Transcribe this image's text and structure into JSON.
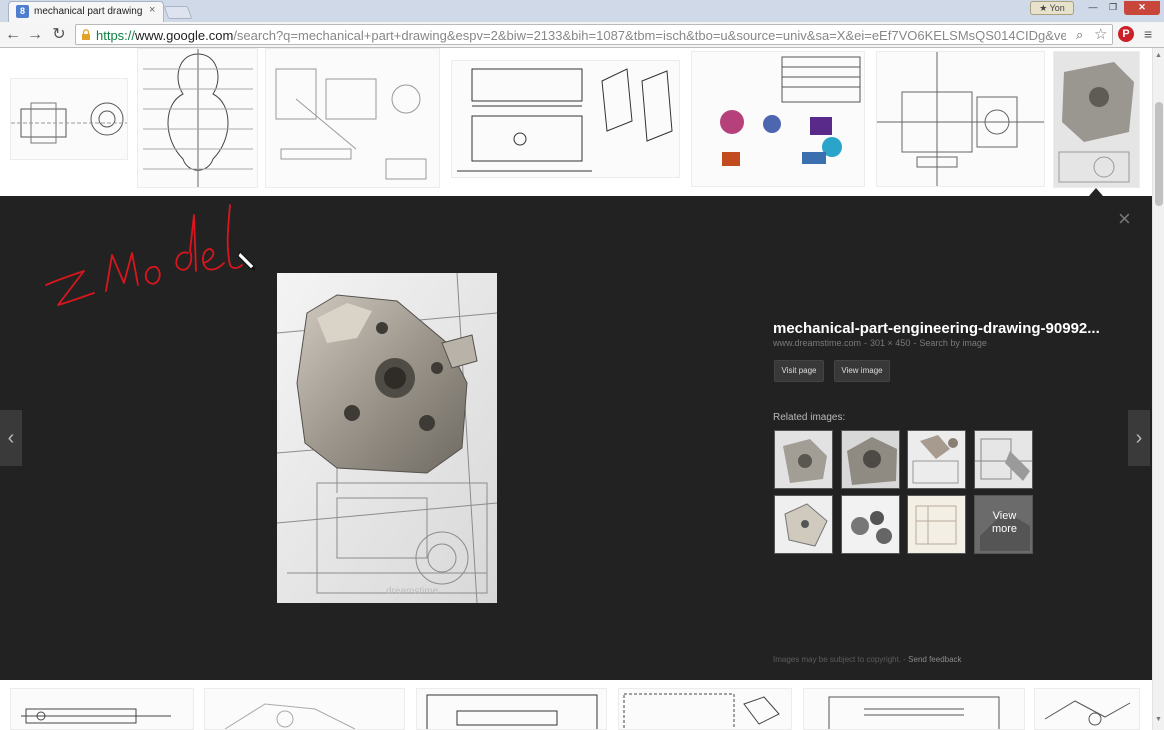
{
  "browser": {
    "tab_title": "mechanical part drawing",
    "tab_favicon": "8",
    "tab_close": "×",
    "profile_label": "Yon",
    "url_scheme": "https://",
    "url_host": "www.google.com",
    "url_rest": "/search?q=mechanical+part+drawing&espv=2&biw=2133&bih=1087&tbm=isch&tbo=u&source=univ&sa=X&ei=eEf7VO6KELSMsQS014CIDg&ved",
    "icons": [
      "back-icon",
      "forward-icon",
      "reload-icon",
      "lock-icon",
      "search-icon",
      "star-icon",
      "pinterest-icon",
      "menu-icon"
    ]
  },
  "preview": {
    "title": "mechanical-part-engineering-drawing-90992...",
    "source_domain": "www.dreamstime.com",
    "dimensions": "301 × 450",
    "search_by_image": "Search by image",
    "visit_page_label": "Visit page",
    "view_image_label": "View image",
    "related_label": "Related images:",
    "view_more_line1": "View",
    "view_more_line2": "more",
    "watermark_text": "dreamstime",
    "copyright_text": "Images may be subject to copyright.",
    "feedback_label": "Send feedback",
    "close_glyph": "×",
    "prev_glyph": "‹",
    "next_glyph": "›"
  },
  "annotation_text": "ZModel",
  "colors": {
    "panel_bg": "#222222",
    "annotation": "#d9161d",
    "url_scheme": "#0b8043"
  }
}
